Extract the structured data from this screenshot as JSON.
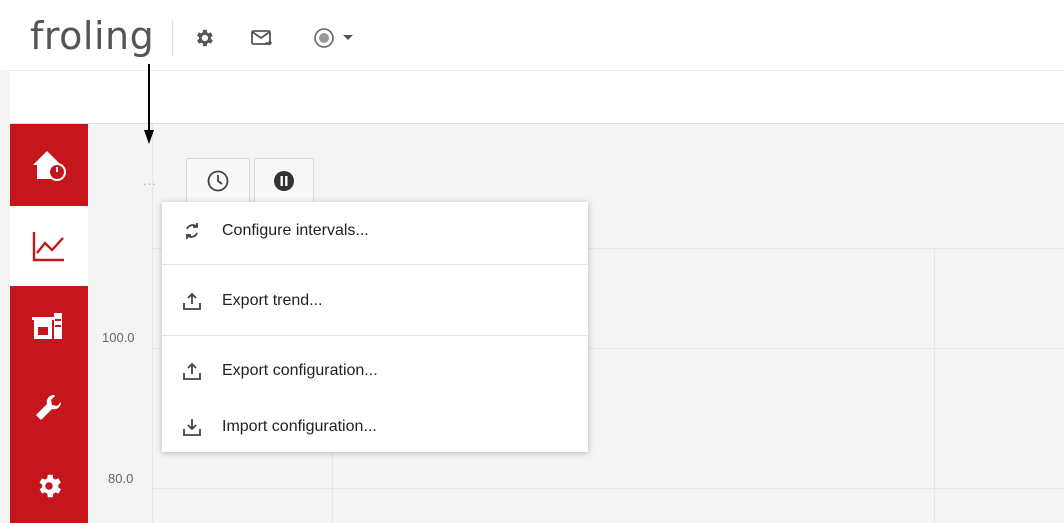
{
  "header": {
    "logo_text": "froling",
    "icons": [
      "gear-icon",
      "mail-forward-icon",
      "status-circle-icon",
      "caret-down-icon"
    ]
  },
  "sidebar": {
    "accent_color": "#c4161c",
    "items": [
      {
        "name": "home-power",
        "active": false
      },
      {
        "name": "trend-chart",
        "active": true
      },
      {
        "name": "boiler-system",
        "active": false
      },
      {
        "name": "wrench-service",
        "active": false
      },
      {
        "name": "settings-gear",
        "active": false
      }
    ]
  },
  "toolbar": {
    "more_label": "...",
    "icons": [
      "clock-icon",
      "pause-icon"
    ]
  },
  "chart": {
    "y_ticks": [
      "100.0",
      "80.0"
    ]
  },
  "menu": {
    "items": [
      {
        "label": "Configure intervals...",
        "icon": "refresh-icon"
      },
      {
        "label": "Export trend...",
        "icon": "upload-icon"
      },
      {
        "label": "Export configuration...",
        "icon": "upload-icon"
      },
      {
        "label": "Import configuration...",
        "icon": "download-icon"
      }
    ]
  }
}
